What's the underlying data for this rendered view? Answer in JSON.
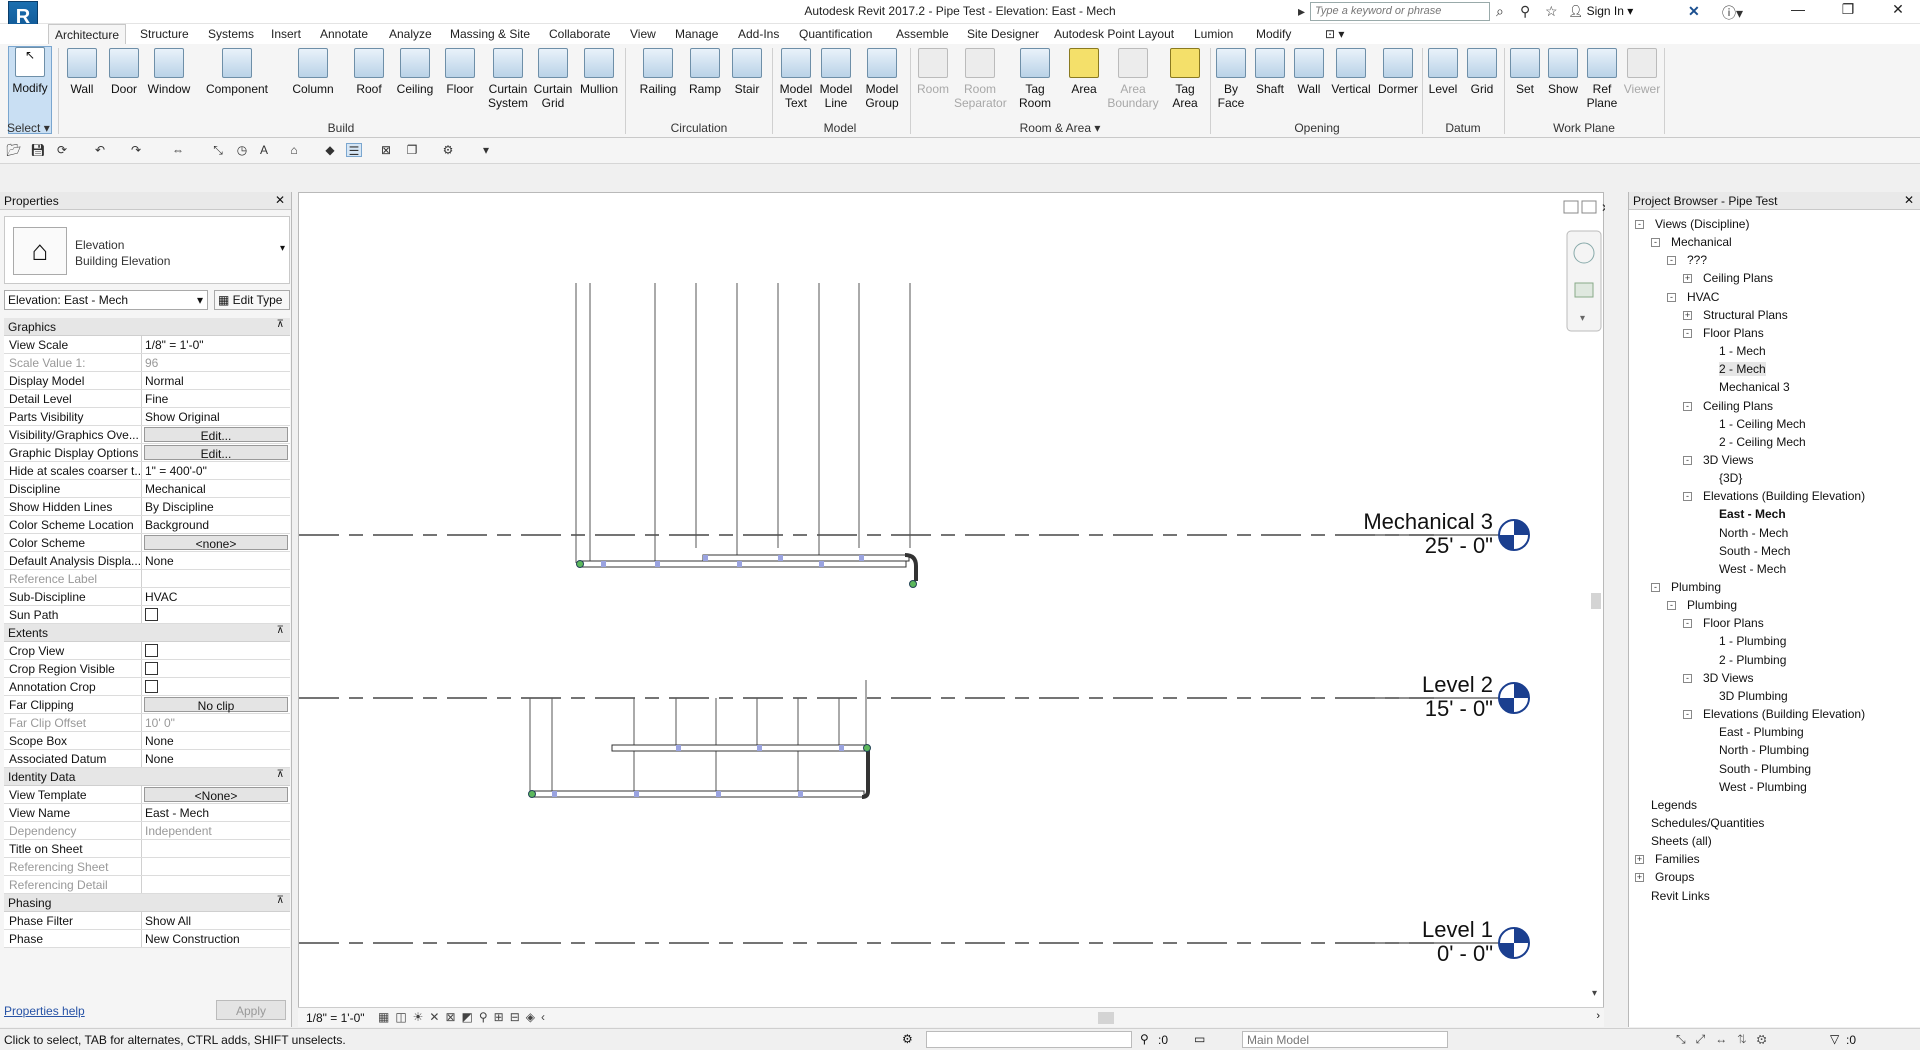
{
  "window": {
    "title": "Autodesk Revit 2017.2 -    Pipe Test - Elevation: East - Mech",
    "search_placeholder": "Type a keyword or phrase",
    "sign_in": "Sign In",
    "logo": "R"
  },
  "tabs": [
    "Architecture",
    "Structure",
    "Systems",
    "Insert",
    "Annotate",
    "Analyze",
    "Massing & Site",
    "Collaborate",
    "View",
    "Manage",
    "Add-Ins",
    "Quantification",
    "Assemble",
    "Site Designer",
    "Autodesk Point Layout",
    "Lumion",
    "Modify"
  ],
  "ribbon": {
    "select": {
      "modify": "Modify",
      "select": "Select"
    },
    "build": [
      "Wall",
      "Door",
      "Window",
      "Component",
      "Column",
      "Roof",
      "Ceiling",
      "Floor",
      "Curtain System",
      "Curtain Grid",
      "Mullion"
    ],
    "circulation": [
      "Railing",
      "Ramp",
      "Stair"
    ],
    "model": [
      "Model Text",
      "Model Line",
      "Model Group"
    ],
    "room_area": [
      "Room",
      "Room Separator",
      "Tag Room",
      "Area",
      "Area Boundary",
      "Tag Area"
    ],
    "opening": [
      "By Face",
      "Shaft",
      "Wall",
      "Vertical",
      "Dormer"
    ],
    "datum": [
      "Level",
      "Grid"
    ],
    "work_plane": [
      "Set",
      "Show",
      "Ref Plane",
      "Viewer"
    ],
    "panels": [
      "Build",
      "Circulation",
      "Model",
      "Room & Area",
      "Opening",
      "Datum",
      "Work Plane"
    ]
  },
  "properties": {
    "title": "Properties",
    "type_family": "Elevation",
    "type_name": "Building Elevation",
    "instance": "Elevation: East - Mech",
    "edit_type": "Edit Type",
    "sections": [
      {
        "name": "Graphics",
        "rows": [
          [
            "View Scale",
            "1/8\" = 1'-0\""
          ],
          [
            "Scale Value    1:",
            "96",
            "dim"
          ],
          [
            "Display Model",
            "Normal"
          ],
          [
            "Detail Level",
            "Fine"
          ],
          [
            "Parts Visibility",
            "Show Original"
          ],
          [
            "Visibility/Graphics Ove...",
            "Edit...",
            "btn"
          ],
          [
            "Graphic Display Options",
            "Edit...",
            "btn"
          ],
          [
            "Hide at scales coarser t...",
            "1\" = 400'-0\""
          ],
          [
            "Discipline",
            "Mechanical"
          ],
          [
            "Show Hidden Lines",
            "By Discipline"
          ],
          [
            "Color Scheme Location",
            "Background"
          ],
          [
            "Color Scheme",
            "<none>",
            "btn"
          ],
          [
            "Default Analysis Displa...",
            "None"
          ],
          [
            "Reference Label",
            "",
            "dim"
          ],
          [
            "Sub-Discipline",
            "HVAC"
          ],
          [
            "Sun Path",
            "",
            "chk"
          ]
        ]
      },
      {
        "name": "Extents",
        "rows": [
          [
            "Crop View",
            "",
            "chk"
          ],
          [
            "Crop Region Visible",
            "",
            "chk"
          ],
          [
            "Annotation Crop",
            "",
            "chk"
          ],
          [
            "Far Clipping",
            "No clip",
            "btn"
          ],
          [
            "Far Clip Offset",
            "10'  0\"",
            "dim"
          ],
          [
            "Scope Box",
            "None"
          ],
          [
            "Associated Datum",
            "None"
          ]
        ]
      },
      {
        "name": "Identity Data",
        "rows": [
          [
            "View Template",
            "<None>",
            "btn"
          ],
          [
            "View Name",
            "East - Mech"
          ],
          [
            "Dependency",
            "Independent",
            "dim"
          ],
          [
            "Title on Sheet",
            ""
          ],
          [
            "Referencing Sheet",
            "",
            "dim"
          ],
          [
            "Referencing Detail",
            "",
            "dim"
          ]
        ]
      },
      {
        "name": "Phasing",
        "rows": [
          [
            "Phase Filter",
            "Show All"
          ],
          [
            "Phase",
            "New Construction"
          ]
        ]
      }
    ],
    "help": "Properties help",
    "apply": "Apply"
  },
  "levels": [
    {
      "name": "Mechanical 3",
      "elev": "25' - 0\""
    },
    {
      "name": "Level 2",
      "elev": "15' - 0\""
    },
    {
      "name": "Level 1",
      "elev": "0' - 0\""
    }
  ],
  "view_scale": "1/8\" = 1'-0\"",
  "browser": {
    "title": "Project Browser - Pipe Test",
    "nodes": [
      {
        "t": "Views (Discipline)",
        "d": 0,
        "e": "-"
      },
      {
        "t": "Mechanical",
        "d": 1,
        "e": "-"
      },
      {
        "t": "???",
        "d": 2,
        "e": "-"
      },
      {
        "t": "Ceiling Plans",
        "d": 3,
        "e": "+"
      },
      {
        "t": "HVAC",
        "d": 2,
        "e": "-"
      },
      {
        "t": "Structural Plans",
        "d": 3,
        "e": "+"
      },
      {
        "t": "Floor Plans",
        "d": 3,
        "e": "-"
      },
      {
        "t": "1 - Mech",
        "d": 4
      },
      {
        "t": "2 - Mech",
        "d": 4,
        "s": 1
      },
      {
        "t": "Mechanical 3",
        "d": 4
      },
      {
        "t": "Ceiling Plans",
        "d": 3,
        "e": "-"
      },
      {
        "t": "1 - Ceiling Mech",
        "d": 4
      },
      {
        "t": "2 - Ceiling Mech",
        "d": 4
      },
      {
        "t": "3D Views",
        "d": 3,
        "e": "-"
      },
      {
        "t": "{3D}",
        "d": 4
      },
      {
        "t": "Elevations (Building Elevation)",
        "d": 3,
        "e": "-"
      },
      {
        "t": "East - Mech",
        "d": 4,
        "b": 1
      },
      {
        "t": "North - Mech",
        "d": 4
      },
      {
        "t": "South - Mech",
        "d": 4
      },
      {
        "t": "West - Mech",
        "d": 4
      },
      {
        "t": "Plumbing",
        "d": 1,
        "e": "-"
      },
      {
        "t": "Plumbing",
        "d": 2,
        "e": "-"
      },
      {
        "t": "Floor Plans",
        "d": 3,
        "e": "-"
      },
      {
        "t": "1 - Plumbing",
        "d": 4
      },
      {
        "t": "2 - Plumbing",
        "d": 4
      },
      {
        "t": "3D Views",
        "d": 3,
        "e": "-"
      },
      {
        "t": "3D Plumbing",
        "d": 4
      },
      {
        "t": "Elevations (Building Elevation)",
        "d": 3,
        "e": "-"
      },
      {
        "t": "East - Plumbing",
        "d": 4
      },
      {
        "t": "North - Plumbing",
        "d": 4
      },
      {
        "t": "South - Plumbing",
        "d": 4
      },
      {
        "t": "West - Plumbing",
        "d": 4
      },
      {
        "t": "Legends",
        "d": 0
      },
      {
        "t": "Schedules/Quantities",
        "d": 0
      },
      {
        "t": "Sheets (all)",
        "d": 0
      },
      {
        "t": "Families",
        "d": 0,
        "e": "+"
      },
      {
        "t": "Groups",
        "d": 0,
        "e": "+"
      },
      {
        "t": "Revit Links",
        "d": 0
      }
    ]
  },
  "status": {
    "message": "Click to select, TAB for alternates, CTRL adds, SHIFT unselects.",
    "model": "Main Model",
    "count1": ":0",
    "count2": ":0"
  }
}
